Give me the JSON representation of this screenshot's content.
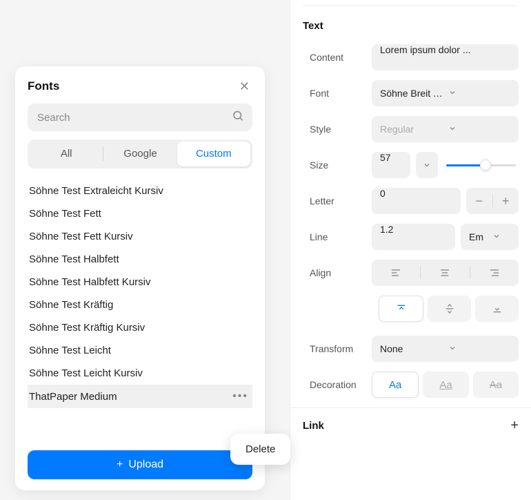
{
  "fontsPanel": {
    "title": "Fonts",
    "searchPlaceholder": "Search",
    "tabs": {
      "all": "All",
      "google": "Google",
      "custom": "Custom"
    },
    "list": [
      "Söhne Test Extraleicht Kursiv",
      "Söhne Test Fett",
      "Söhne Test Fett Kursiv",
      "Söhne Test Halbfett",
      "Söhne Test Halbfett Kursiv",
      "Söhne Test Kräftig",
      "Söhne Test Kräftig Kursiv",
      "Söhne Test Leicht",
      "Söhne Test Leicht Kursiv",
      "ThatPaper Medium"
    ],
    "uploadLabel": "Upload",
    "contextMenu": {
      "delete": "Delete"
    }
  },
  "textPanel": {
    "title": "Text",
    "labels": {
      "content": "Content",
      "font": "Font",
      "style": "Style",
      "size": "Size",
      "letter": "Letter",
      "line": "Line",
      "align": "Align",
      "transform": "Transform",
      "decoration": "Decoration"
    },
    "values": {
      "content": "Lorem ipsum dolor ...",
      "font": "Söhne Breit Test L...",
      "style": "Regular",
      "size": "57",
      "letter": "0",
      "line": "1.2",
      "lineUnit": "Em",
      "transform": "None",
      "decoA": "Aa",
      "decoB": "Aa",
      "decoC": "Aa"
    }
  },
  "linkSection": {
    "title": "Link"
  }
}
